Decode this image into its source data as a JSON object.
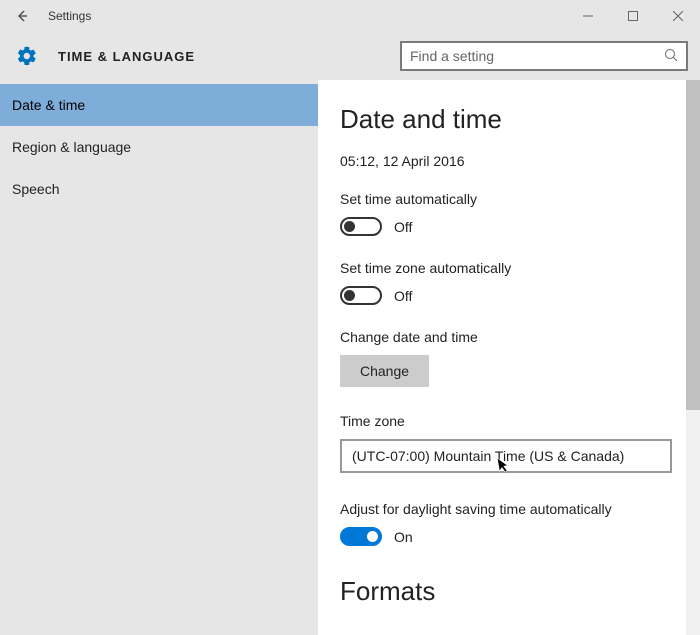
{
  "window": {
    "title": "Settings"
  },
  "header": {
    "title": "TIME & LANGUAGE",
    "search_placeholder": "Find a setting"
  },
  "sidebar": {
    "items": [
      {
        "label": "Date & time",
        "active": true
      },
      {
        "label": "Region & language",
        "active": false
      },
      {
        "label": "Speech",
        "active": false
      }
    ]
  },
  "content": {
    "title": "Date and time",
    "current_datetime": "05:12, 12 April 2016",
    "set_time_auto": {
      "label": "Set time automatically",
      "state": "Off"
    },
    "set_tz_auto": {
      "label": "Set time zone automatically",
      "state": "Off"
    },
    "change_dt": {
      "label": "Change date and time",
      "button": "Change"
    },
    "timezone": {
      "label": "Time zone",
      "value": "(UTC-07:00) Mountain Time (US & Canada)"
    },
    "dst": {
      "label": "Adjust for daylight saving time automatically",
      "state": "On"
    },
    "formats_title": "Formats"
  }
}
